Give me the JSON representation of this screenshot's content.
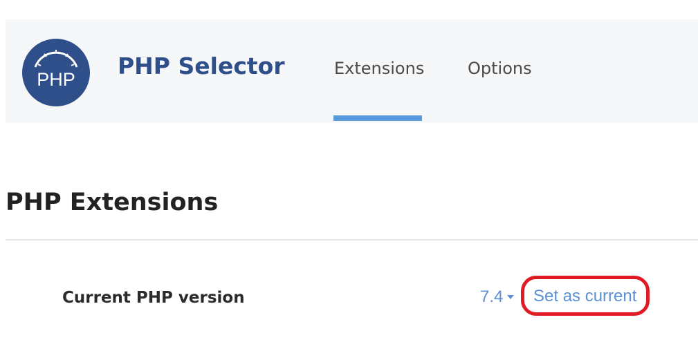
{
  "header": {
    "logo_text": "PHP",
    "app_title": "PHP Selector",
    "tabs": [
      {
        "label": "Extensions",
        "active": true
      },
      {
        "label": "Options",
        "active": false
      }
    ],
    "active_tab_color": "#5b9be0"
  },
  "main": {
    "page_title": "PHP Extensions",
    "current_version": {
      "label": "Current PHP version",
      "selected_value": "7.4",
      "action_link": "Set as current"
    }
  },
  "colors": {
    "brand": "#2f4f8a",
    "link": "#5b8fd3",
    "highlight": "#e01b24"
  },
  "icons": {
    "logo": "php-gauge-logo",
    "dropdown": "caret-down-icon"
  }
}
